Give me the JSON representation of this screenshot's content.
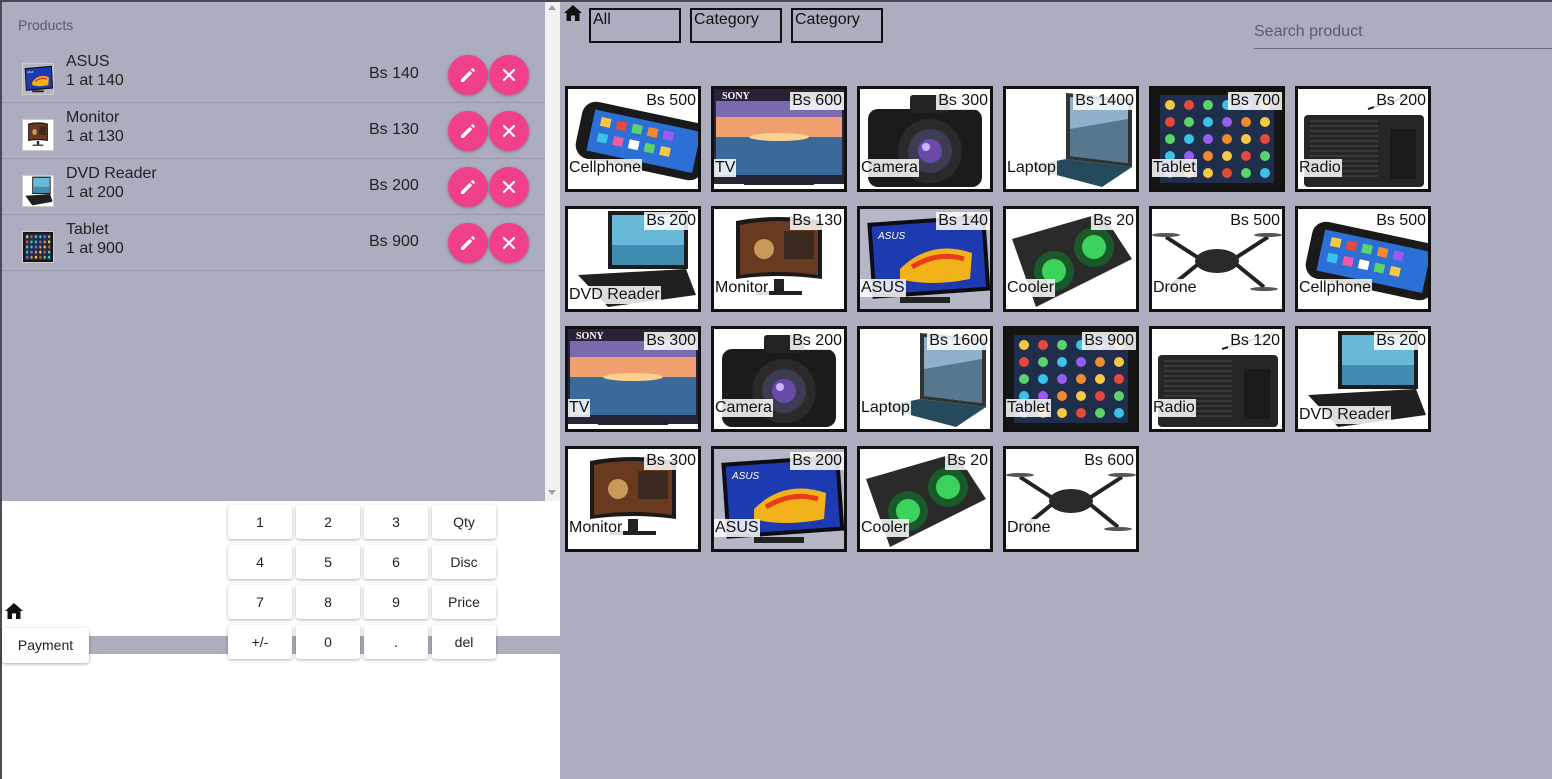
{
  "order_panel": {
    "header": "Products",
    "items": [
      {
        "name": "ASUS",
        "qty": "1 at 140",
        "price": "Bs 140",
        "thumb": "asus"
      },
      {
        "name": "Monitor",
        "qty": "1 at 130",
        "price": "Bs 130",
        "thumb": "monitor"
      },
      {
        "name": "DVD Reader",
        "qty": "1 at 200",
        "price": "Bs 200",
        "thumb": "dvd"
      },
      {
        "name": "Tablet",
        "qty": "1 at 900",
        "price": "Bs 900",
        "thumb": "tablet"
      }
    ]
  },
  "numpad": {
    "keys": [
      "1",
      "2",
      "3",
      "Qty",
      "4",
      "5",
      "6",
      "Disc",
      "7",
      "8",
      "9",
      "Price",
      "+/-",
      "0",
      ".",
      "del"
    ]
  },
  "payment_label": "Payment",
  "category_tabs": [
    "All",
    "Category",
    "Category"
  ],
  "search": {
    "placeholder": "Search product"
  },
  "products": [
    {
      "name": "Cellphone",
      "price": "Bs 500",
      "kind": "phone"
    },
    {
      "name": "TV",
      "price": "Bs 600",
      "kind": "tv"
    },
    {
      "name": "Camera",
      "price": "Bs 300",
      "kind": "camera"
    },
    {
      "name": "Laptop",
      "price": "Bs 1400",
      "kind": "laptop"
    },
    {
      "name": "Tablet",
      "price": "Bs 700",
      "kind": "tablet"
    },
    {
      "name": "Radio",
      "price": "Bs 200",
      "kind": "radio"
    },
    {
      "name": "DVD Reader",
      "price": "Bs 200",
      "kind": "dvd"
    },
    {
      "name": "Monitor",
      "price": "Bs 130",
      "kind": "monitor"
    },
    {
      "name": "ASUS",
      "price": "Bs 140",
      "kind": "asus"
    },
    {
      "name": "Cooler",
      "price": "Bs 20",
      "kind": "cooler"
    },
    {
      "name": "Drone",
      "price": "Bs 500",
      "kind": "drone"
    },
    {
      "name": "Cellphone",
      "price": "Bs 500",
      "kind": "phone"
    },
    {
      "name": "TV",
      "price": "Bs 300",
      "kind": "tv"
    },
    {
      "name": "Camera",
      "price": "Bs 200",
      "kind": "camera"
    },
    {
      "name": "Laptop",
      "price": "Bs 1600",
      "kind": "laptop"
    },
    {
      "name": "Tablet",
      "price": "Bs 900",
      "kind": "tablet"
    },
    {
      "name": "Radio",
      "price": "Bs 120",
      "kind": "radio"
    },
    {
      "name": "DVD Reader",
      "price": "Bs 200",
      "kind": "dvd"
    },
    {
      "name": "Monitor",
      "price": "Bs 300",
      "kind": "monitor"
    },
    {
      "name": "ASUS",
      "price": "Bs 200",
      "kind": "asus"
    },
    {
      "name": "Cooler",
      "price": "Bs 20",
      "kind": "cooler"
    },
    {
      "name": "Drone",
      "price": "Bs 600",
      "kind": "drone"
    }
  ],
  "colors": {
    "background": "#acadbf",
    "accent": "#f0408a",
    "tile_border": "#111111"
  },
  "icons": {
    "home": "home-icon",
    "edit": "pencil-icon",
    "remove": "close-icon"
  }
}
